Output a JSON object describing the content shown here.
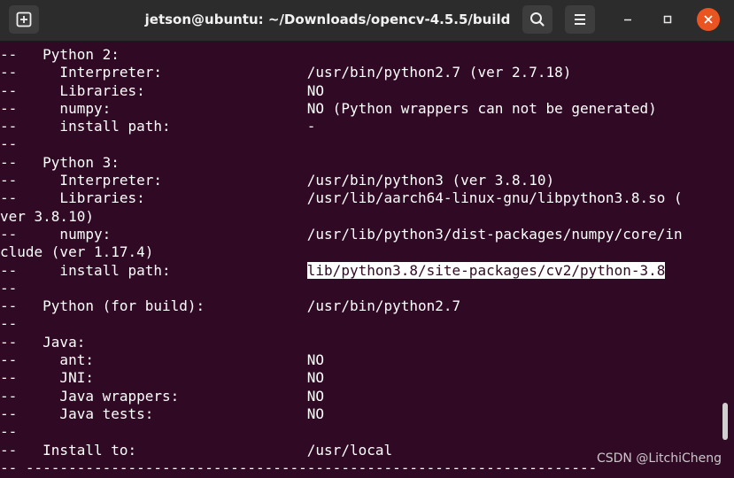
{
  "window": {
    "title": "jetson@ubuntu: ~/Downloads/opencv-4.5.5/build",
    "new_tab_icon": "new-tab-icon",
    "search_icon": "search-icon",
    "menu_icon": "hamburger-menu-icon",
    "close_color": "#e95420"
  },
  "terminal": {
    "background": "#300a24",
    "lines": [
      {
        "pre": "--   Python 2:"
      },
      {
        "pre": "--     Interpreter:                 /usr/bin/python2.7 (ver 2.7.18)"
      },
      {
        "pre": "--     Libraries:                   NO"
      },
      {
        "pre": "--     numpy:                       NO (Python wrappers can not be generated)"
      },
      {
        "pre": "--     install path:                -"
      },
      {
        "pre": "--"
      },
      {
        "pre": "--   Python 3:"
      },
      {
        "pre": "--     Interpreter:                 /usr/bin/python3 (ver 3.8.10)"
      },
      {
        "pre": "--     Libraries:                   /usr/lib/aarch64-linux-gnu/libpython3.8.so ("
      },
      {
        "pre": "ver 3.8.10)"
      },
      {
        "pre": "--     numpy:                       /usr/lib/python3/dist-packages/numpy/core/in"
      },
      {
        "pre": "clude (ver 1.17.4)"
      },
      {
        "pre": "--     install path:                ",
        "hl": "lib/python3.8/site-packages/cv2/python-3.8"
      },
      {
        "pre": "--"
      },
      {
        "pre": "--   Python (for build):            /usr/bin/python2.7"
      },
      {
        "pre": "--"
      },
      {
        "pre": "--   Java:"
      },
      {
        "pre": "--     ant:                         NO"
      },
      {
        "pre": "--     JNI:                         NO"
      },
      {
        "pre": "--     Java wrappers:               NO"
      },
      {
        "pre": "--     Java tests:                  NO"
      },
      {
        "pre": "--"
      },
      {
        "pre": "--   Install to:                    /usr/local"
      },
      {
        "pre": "-- -------------------------------------------------------------------"
      }
    ]
  },
  "watermark": "CSDN @LitchiCheng"
}
